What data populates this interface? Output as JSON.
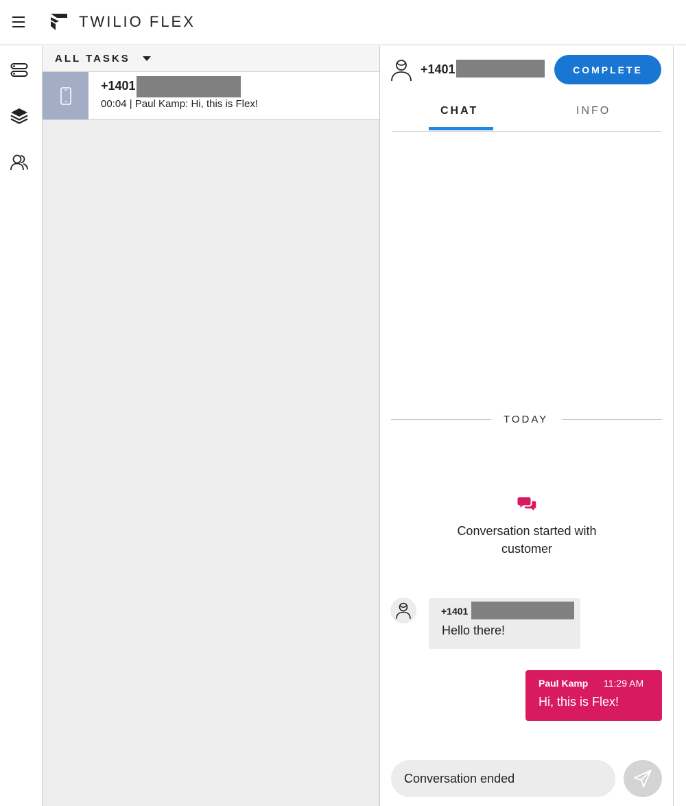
{
  "header": {
    "brand": "TWILIO FLEX",
    "menu_icon": "hamburger-icon",
    "logo_icon": "twilio-flex-logo"
  },
  "sidebar": {
    "items": [
      {
        "icon": "agent-desktop-icon"
      },
      {
        "icon": "layers-icon"
      },
      {
        "icon": "teams-icon"
      }
    ]
  },
  "tasks": {
    "filter_label": "ALL TASKS",
    "items": [
      {
        "title": "+1401",
        "subtitle": "00:04 | Paul Kamp: Hi, this is Flex!",
        "channel_icon": "phone-icon"
      }
    ]
  },
  "panel": {
    "contact": "+1401",
    "complete_label": "COMPLETE",
    "tabs": [
      {
        "label": "CHAT",
        "active": true
      },
      {
        "label": "INFO",
        "active": false
      }
    ],
    "day_label": "TODAY",
    "conversation_started": "Conversation started with customer",
    "messages": [
      {
        "author": "+1401",
        "body": "Hello there!",
        "direction": "inbound"
      },
      {
        "author": "Paul Kamp",
        "time": "11:29 AM",
        "body": "Hi, this is Flex!",
        "direction": "outbound"
      }
    ],
    "input_value": "Conversation ended"
  },
  "colors": {
    "accent_blue": "#1976d2",
    "tab_underline": "#1e88e5",
    "outbound_bubble": "#d81b60",
    "chat_icon": "#d81b60",
    "task_icon_bg": "#a3aec6",
    "redaction": "#808080"
  }
}
